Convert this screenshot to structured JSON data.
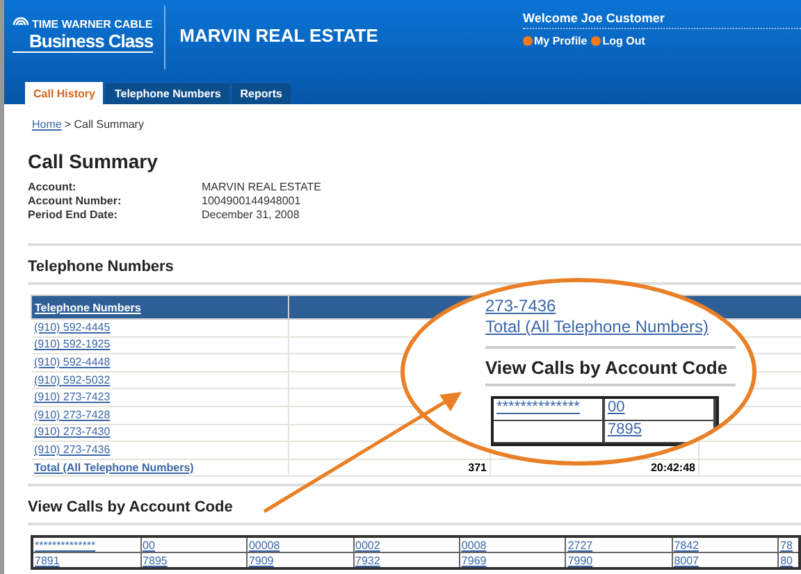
{
  "header": {
    "logo_line1": "TIME WARNER CABLE",
    "logo_line2": "Business Class",
    "company": "MARVIN REAL ESTATE",
    "welcome": "Welcome Joe Customer",
    "links": [
      "My Profile",
      "Log Out"
    ]
  },
  "tabs": [
    {
      "label": "Call History",
      "selected": true
    },
    {
      "label": "Telephone Numbers",
      "selected": false
    },
    {
      "label": "Reports",
      "selected": false
    }
  ],
  "breadcrumb": {
    "link": "Home",
    "current": "> Call Summary"
  },
  "title": "Call Summary",
  "info": [
    {
      "label": "Account:",
      "value": "MARVIN REAL ESTATE"
    },
    {
      "label": "Account Number:",
      "value": "1004900144948001"
    },
    {
      "label": "Period End Date:",
      "value": "December 31, 2008"
    }
  ],
  "telephone_section": {
    "heading": "Telephone Numbers",
    "column_header": "Telephone Numbers",
    "numbers": [
      "(910) 592-4445",
      "(910) 592-1925",
      "(910) 592-4448",
      "(910) 592-5032",
      "(910) 273-7423",
      "(910) 273-7428",
      "(910) 273-7430",
      "(910) 273-7436"
    ],
    "total_label": "Total (All Telephone Numbers)",
    "total_calls": "371",
    "total_duration": "20:42:48"
  },
  "account_section": {
    "heading": "View Calls by Account Code",
    "rows": [
      [
        "**************",
        "00",
        "00008",
        "0002",
        "0008",
        "2727",
        "7842",
        "78"
      ],
      [
        "7891",
        "7895",
        "7909",
        "7932",
        "7969",
        "7990",
        "8007",
        "80"
      ]
    ]
  },
  "callout": {
    "number": "273-7436",
    "total_label": "Total (All Telephone Numbers)",
    "heading": "View Calls by Account Code",
    "rows": [
      [
        "**************",
        "00"
      ],
      [
        "",
        "7895"
      ]
    ]
  }
}
